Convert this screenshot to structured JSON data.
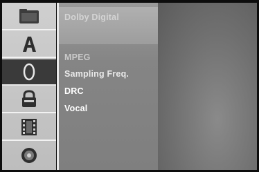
{
  "sidebar": {
    "items": [
      {
        "icon": "folder-icon"
      },
      {
        "icon": "letter-a-icon"
      },
      {
        "icon": "audio-icon",
        "selected": true
      },
      {
        "icon": "lock-icon"
      },
      {
        "icon": "film-icon"
      },
      {
        "icon": "disc-icon"
      }
    ]
  },
  "menu": {
    "items": [
      {
        "label": "Dolby Digital"
      },
      {
        "label": "MPEG"
      },
      {
        "label": "Sampling Freq."
      },
      {
        "label": "DRC"
      },
      {
        "label": "Vocal"
      }
    ]
  }
}
